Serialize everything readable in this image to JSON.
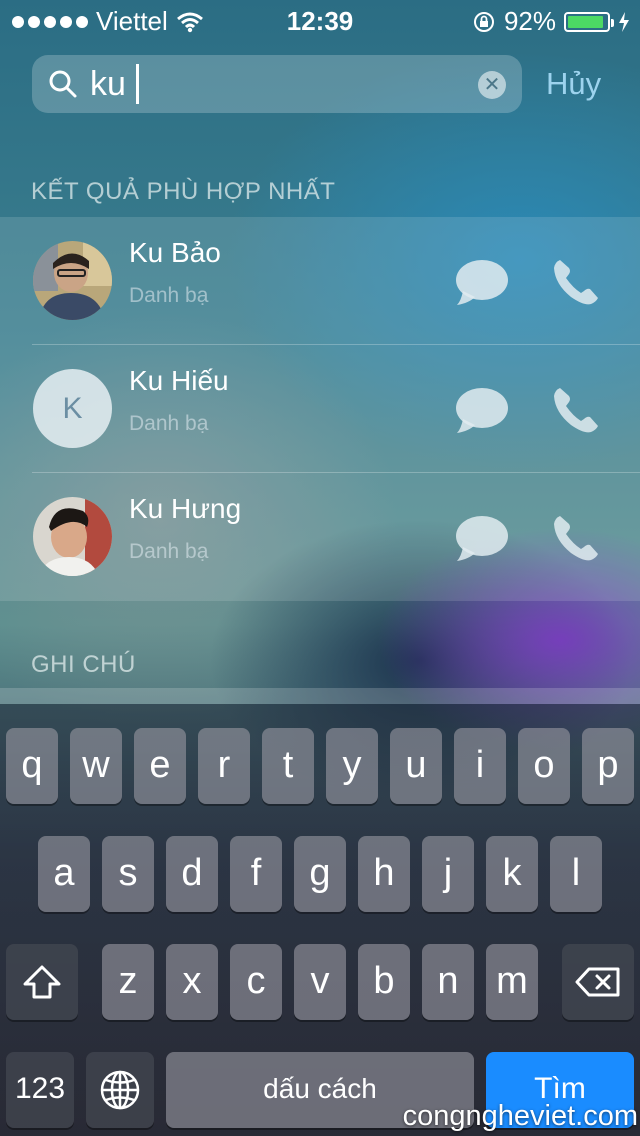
{
  "status_bar": {
    "carrier": "Viettel",
    "time": "12:39",
    "battery_percent": "92%",
    "battery_level": 0.92
  },
  "search": {
    "query": "ku",
    "cancel_label": "Hủy"
  },
  "sections": {
    "top_hits": "KẾT QUẢ PHÙ HỢP NHẤT",
    "notes": "GHI CHÚ"
  },
  "contacts": [
    {
      "name": "Ku Bảo",
      "subtitle": "Danh bạ",
      "avatar": "photo"
    },
    {
      "name": "Ku Hiếu",
      "subtitle": "Danh bạ",
      "avatar": "initial",
      "initial": "K"
    },
    {
      "name": "Ku Hưng",
      "subtitle": "Danh bạ",
      "avatar": "photo"
    }
  ],
  "keyboard": {
    "row1": [
      "q",
      "w",
      "e",
      "r",
      "t",
      "y",
      "u",
      "i",
      "o",
      "p"
    ],
    "row2": [
      "a",
      "s",
      "d",
      "f",
      "g",
      "h",
      "j",
      "k",
      "l"
    ],
    "row3": [
      "z",
      "x",
      "c",
      "v",
      "b",
      "n",
      "m"
    ],
    "numbers_label": "123",
    "space_label": "dấu cách",
    "go_label": "Tìm"
  },
  "watermark": "congngheviet.com",
  "colors": {
    "accent": "#1a8cff",
    "battery": "#4cd964",
    "cancel": "#9dd3ee"
  }
}
